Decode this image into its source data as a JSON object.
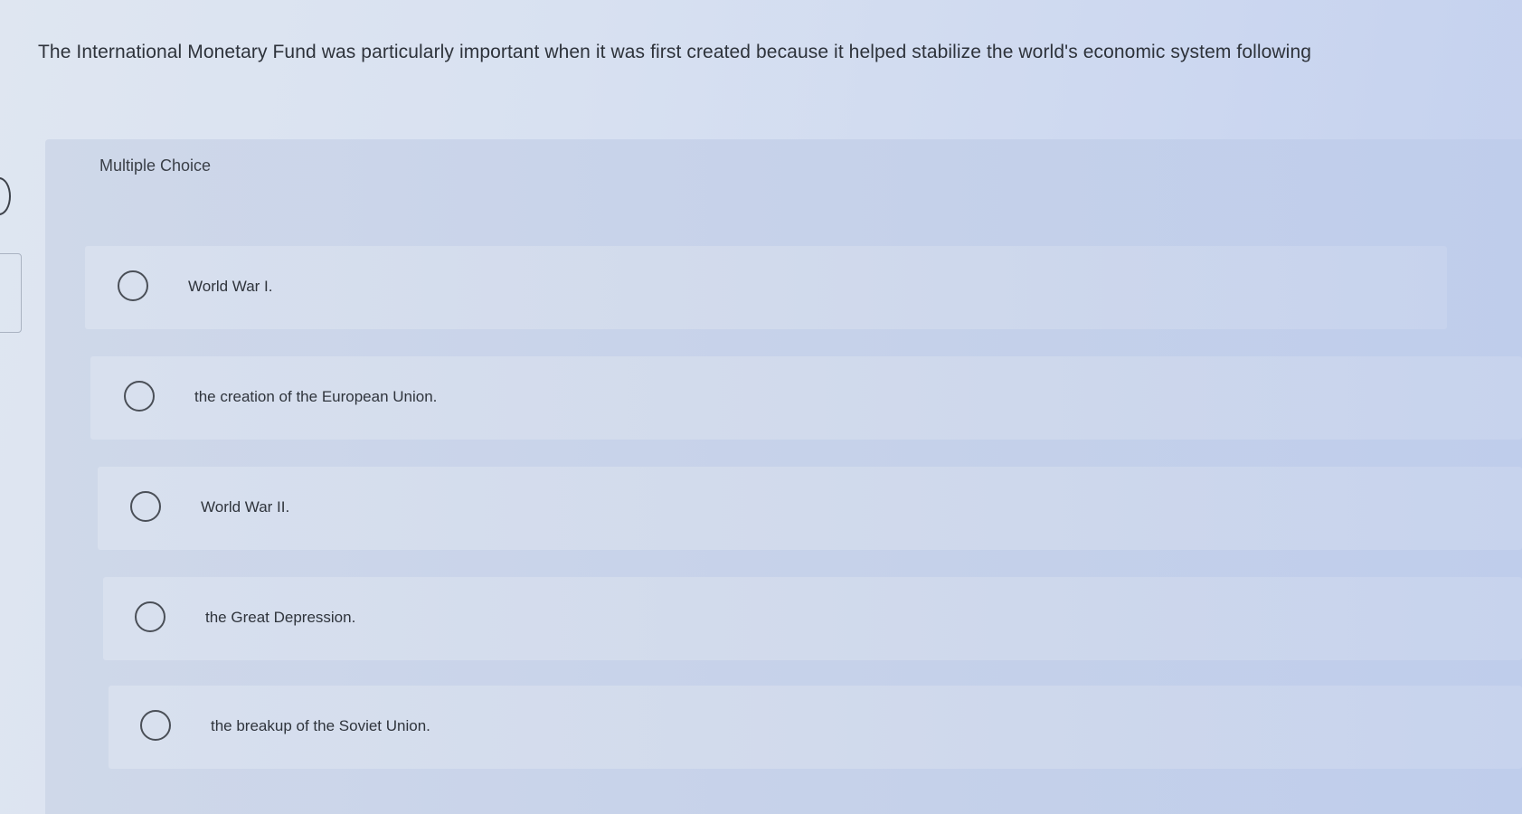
{
  "question": {
    "text": "The International Monetary Fund was particularly important when it was first created because it helped stabilize the world's economic system following"
  },
  "answer_section": {
    "label": "Multiple Choice",
    "choices": [
      {
        "text": "World War I."
      },
      {
        "text": "the creation of the European Union."
      },
      {
        "text": "World War II."
      },
      {
        "text": "the Great Depression."
      },
      {
        "text": "the breakup of the Soviet Union."
      }
    ]
  }
}
